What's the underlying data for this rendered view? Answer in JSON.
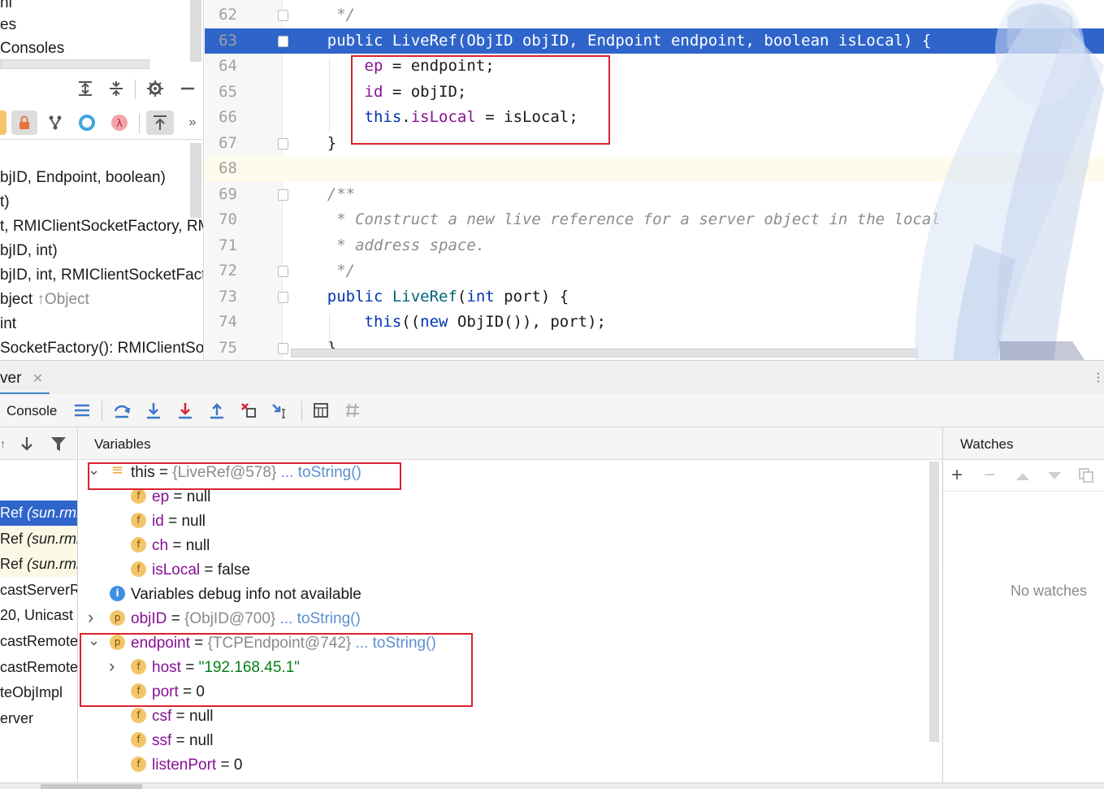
{
  "structure": {
    "top_fragments": [
      "nl",
      "es",
      "Consoles"
    ],
    "items": [
      {
        "text": "bjID, Endpoint, boolean)",
        "suffix": ""
      },
      {
        "text": "t)",
        "suffix": ""
      },
      {
        "text": "t, RMIClientSocketFactory, RM",
        "suffix": ""
      },
      {
        "text": "bjID, int)",
        "suffix": ""
      },
      {
        "text": "bjID, int, RMIClientSocketFact",
        "suffix": ""
      },
      {
        "text": "bject ",
        "suffix": "↑Object"
      },
      {
        "text": " int",
        "suffix": ""
      },
      {
        "text": "SocketFactory(): RMIClientSoc",
        "suffix": ""
      }
    ]
  },
  "editor": {
    "lines": [
      {
        "n": "62",
        "seg": [
          [
            "cmt",
            "     */"
          ]
        ]
      },
      {
        "n": "63",
        "seg": [
          [
            "plain",
            "    public LiveRef(ObjID objID, Endpoint endpoint, boolean isLocal) {"
          ]
        ],
        "exec": true
      },
      {
        "n": "64",
        "seg": [
          [
            "plain",
            "        "
          ],
          [
            "fld",
            "ep"
          ],
          [
            "plain",
            " = endpoint;"
          ]
        ]
      },
      {
        "n": "65",
        "seg": [
          [
            "plain",
            "        "
          ],
          [
            "fld",
            "id"
          ],
          [
            "plain",
            " = objID;"
          ]
        ]
      },
      {
        "n": "66",
        "seg": [
          [
            "plain",
            "        "
          ],
          [
            "kw",
            "this"
          ],
          [
            "plain",
            "."
          ],
          [
            "fld",
            "isLocal"
          ],
          [
            "plain",
            " = isLocal;"
          ]
        ]
      },
      {
        "n": "67",
        "seg": [
          [
            "plain",
            "    }"
          ]
        ]
      },
      {
        "n": "68",
        "seg": [
          [
            "plain",
            ""
          ]
        ],
        "cur": true
      },
      {
        "n": "69",
        "seg": [
          [
            "cmt",
            "    /**"
          ]
        ]
      },
      {
        "n": "70",
        "seg": [
          [
            "cmt",
            "     * Construct a new live reference for a server object in the local"
          ]
        ]
      },
      {
        "n": "71",
        "seg": [
          [
            "cmt",
            "     * address space."
          ]
        ]
      },
      {
        "n": "72",
        "seg": [
          [
            "cmt",
            "     */"
          ]
        ]
      },
      {
        "n": "73",
        "seg": [
          [
            "kw",
            "    public "
          ],
          [
            "fn",
            "LiveRef"
          ],
          [
            "plain",
            "("
          ],
          [
            "kw",
            "int"
          ],
          [
            "plain",
            " port) {"
          ]
        ]
      },
      {
        "n": "74",
        "seg": [
          [
            "plain",
            "        "
          ],
          [
            "kw",
            "this"
          ],
          [
            "plain",
            "(("
          ],
          [
            "kw",
            "new"
          ],
          [
            "plain",
            " ObjID()), port);"
          ]
        ]
      },
      {
        "n": "75",
        "seg": [
          [
            "plain",
            "    }"
          ]
        ]
      }
    ]
  },
  "debug": {
    "tab_label": "ver",
    "console_label": "Console",
    "variables_title": "Variables",
    "watches_title": "Watches",
    "no_watches": "No watches",
    "frames": [
      {
        "text": "Ref ",
        "italic": "(sun.rmi",
        "state": "sel"
      },
      {
        "text": "Ref ",
        "italic": "(sun.rmi",
        "state": "lib"
      },
      {
        "text": "Ref ",
        "italic": "(sun.rmi",
        "state": "lib"
      },
      {
        "text": "castServerR",
        "italic": "",
        "state": ""
      },
      {
        "text": "20, Unicast",
        "italic": "",
        "state": ""
      },
      {
        "text": "castRemote",
        "italic": "",
        "state": ""
      },
      {
        "text": "castRemote",
        "italic": "",
        "state": ""
      },
      {
        "text": "teObjImpl",
        "italic": "",
        "state": ""
      },
      {
        "text": "erver",
        "italic": "",
        "state": ""
      }
    ],
    "variables": [
      {
        "indent": 0,
        "arrow": "⌄",
        "badge": "≡",
        "name": "this",
        "eq": " = ",
        "value": "{LiveRef@578}",
        "vtype": "ref",
        "link": " ... toString()"
      },
      {
        "indent": 1,
        "arrow": "",
        "badge": "f",
        "name": "ep",
        "eq": " = ",
        "value": "null",
        "vtype": "plain",
        "link": ""
      },
      {
        "indent": 1,
        "arrow": "",
        "badge": "f",
        "name": "id",
        "eq": " = ",
        "value": "null",
        "vtype": "plain",
        "link": ""
      },
      {
        "indent": 1,
        "arrow": "",
        "badge": "f",
        "name": "ch",
        "eq": " = ",
        "value": "null",
        "vtype": "plain",
        "link": ""
      },
      {
        "indent": 1,
        "arrow": "",
        "badge": "f",
        "name": "isLocal",
        "eq": " = ",
        "value": "false",
        "vtype": "plain",
        "link": ""
      },
      {
        "indent": 0,
        "arrow": "",
        "badge": "i",
        "name": "Variables debug info not available",
        "eq": "",
        "value": "",
        "vtype": "plain",
        "link": "",
        "plainName": true
      },
      {
        "indent": 0,
        "arrow": "›",
        "badge": "p",
        "name": "objID",
        "eq": " = ",
        "value": "{ObjID@700}",
        "vtype": "ref",
        "link": " ... toString()"
      },
      {
        "indent": 0,
        "arrow": "⌄",
        "badge": "p",
        "name": "endpoint",
        "eq": " = ",
        "value": "{TCPEndpoint@742}",
        "vtype": "ref",
        "link": " ... toString()"
      },
      {
        "indent": 1,
        "arrow": "›",
        "badge": "f",
        "name": "host",
        "eq": " = ",
        "value": "\"192.168.45.1\"",
        "vtype": "str",
        "link": ""
      },
      {
        "indent": 1,
        "arrow": "",
        "badge": "f",
        "name": "port",
        "eq": " = ",
        "value": "0",
        "vtype": "plain",
        "link": ""
      },
      {
        "indent": 1,
        "arrow": "",
        "badge": "f",
        "name": "csf",
        "eq": " = ",
        "value": "null",
        "vtype": "plain",
        "link": ""
      },
      {
        "indent": 1,
        "arrow": "",
        "badge": "f",
        "name": "ssf",
        "eq": " = ",
        "value": "null",
        "vtype": "plain",
        "link": ""
      },
      {
        "indent": 1,
        "arrow": "",
        "badge": "f",
        "name": "listenPort",
        "eq": " = ",
        "value": "0",
        "vtype": "plain",
        "link": ""
      }
    ]
  },
  "colors": {
    "exec_line": "#2f65ca",
    "highlight_box": "#d9232e",
    "field_name": "#871094",
    "keyword": "#0033b3",
    "string": "#067d17"
  },
  "icons": {
    "structure_toolbar": [
      "expand-all-icon",
      "collapse-all-icon",
      "gear-icon",
      "minimize-icon"
    ],
    "structure_filters": [
      "lock-icon",
      "fork-icon",
      "circle-icon",
      "lambda-icon",
      "autoscroll-icon",
      "more-icon"
    ],
    "debug_toolbar": [
      "layout-icon",
      "step-over-icon",
      "step-into-icon",
      "force-step-into-icon",
      "step-out-icon",
      "drop-frame-icon",
      "run-to-cursor-icon",
      "evaluate-icon",
      "trace-icon"
    ],
    "watches_toolbar": [
      "add-icon",
      "remove-icon",
      "up-icon",
      "down-icon",
      "copy-icon"
    ]
  }
}
